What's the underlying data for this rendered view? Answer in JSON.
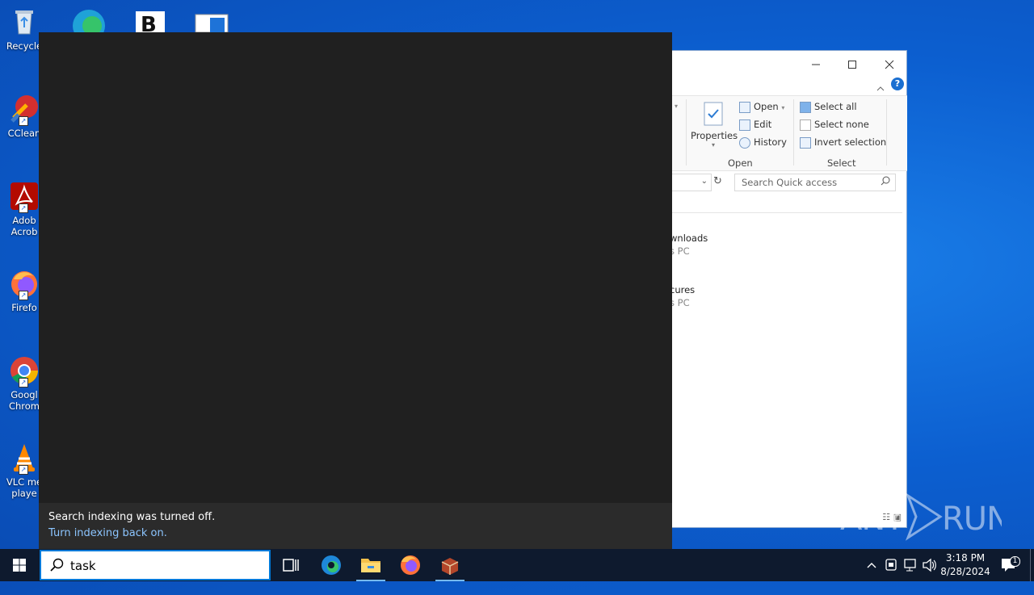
{
  "desktop": {
    "icons": [
      {
        "label": "Recycle"
      },
      {
        "label": "CClean"
      },
      {
        "label": "Adob Acrob"
      },
      {
        "label": "Firefo"
      },
      {
        "label": "Googl Chrom"
      },
      {
        "label": "VLC me playe"
      }
    ]
  },
  "explorer": {
    "ribbon": {
      "open_label": "Open",
      "edit_label": "Edit",
      "history_label": "History",
      "properties_label": "Properties",
      "select_all_label": "Select all",
      "select_none_label": "Select none",
      "invert_selection_label": "Invert selection",
      "group_open": "Open",
      "group_select": "Select"
    },
    "search_placeholder": "Search Quick access",
    "items": [
      {
        "name": "wnloads",
        "location": "s PC"
      },
      {
        "name": "cures",
        "location": "s PC"
      }
    ]
  },
  "search_panel": {
    "indexing_message": "Search indexing was turned off.",
    "indexing_link": "Turn indexing back on."
  },
  "taskbar": {
    "search_value": "task",
    "clock_time": "3:18 PM",
    "clock_date": "8/28/2024",
    "notification_count": "1"
  },
  "watermark": "ANY RUN"
}
